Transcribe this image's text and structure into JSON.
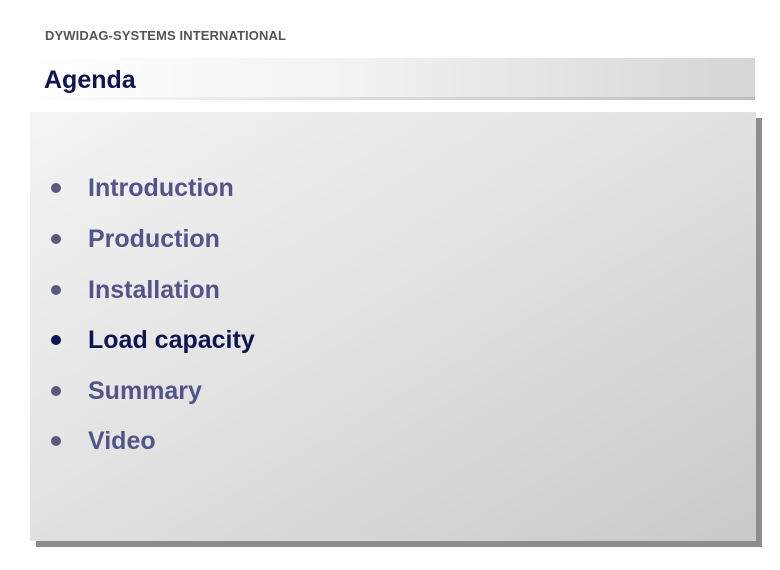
{
  "header": {
    "company": "DYWIDAG-SYSTEMS INTERNATIONAL",
    "title": "Agenda"
  },
  "agenda": {
    "items": [
      {
        "label": "Introduction",
        "state": "muted"
      },
      {
        "label": "Production",
        "state": "muted"
      },
      {
        "label": "Installation",
        "state": "muted"
      },
      {
        "label": "Load capacity",
        "state": "active"
      },
      {
        "label": "Summary",
        "state": "muted"
      },
      {
        "label": "Video",
        "state": "muted"
      }
    ]
  },
  "colors": {
    "title": "#0d1450",
    "active_item": "#0d1450",
    "muted_item": "#54548a",
    "company": "#555555"
  }
}
